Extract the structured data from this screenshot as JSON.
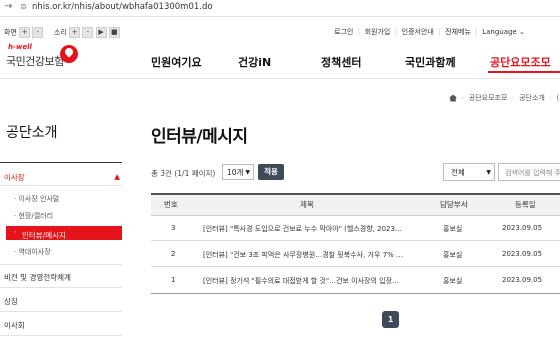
{
  "browser": {
    "url": "nhis.or.kr/nhis/about/wbhafa01300m01.do"
  },
  "util": {
    "screen_label": "화면",
    "sound_label": "소리",
    "zoom_in": "+",
    "zoom_reset": "-",
    "zoom_out": "-",
    "sound_play": "▶",
    "sound_stop": "■",
    "links": [
      "로그인",
      "회원가입",
      "인증서안내",
      "전체메뉴"
    ],
    "language": "Language"
  },
  "logo": {
    "top": "h-well",
    "name": "국민건강보험"
  },
  "gnb": [
    "민원여기요",
    "건강iN",
    "정책센터",
    "국민과함께",
    "공단요모조모"
  ],
  "breadcrumb": [
    "공단요모조모",
    "공단소개",
    "("
  ],
  "sidebar": {
    "title": "공단소개",
    "section": "이사장",
    "subitems": [
      "이사장 인사말",
      "현장/갤러리",
      "인터뷰/메시지",
      "역대이사장"
    ],
    "others": [
      "비전 및 경영전략체계",
      "상징",
      "이사회"
    ]
  },
  "content": {
    "title": "인터뷰/메시지",
    "count_text": "총 3건 (1/1 페이지)",
    "per_page": "10개",
    "apply": "적용",
    "scope": "전체",
    "search_placeholder": "검색어를 입력해 주",
    "headers": [
      "번호",
      "제목",
      "담당부서",
      "등록일"
    ],
    "rows": [
      {
        "no": "3",
        "title": "[인터뷰] \"특사경 도입으로 건보료 누수 막아야\" (헬스경향, 2023…",
        "dept": "홍보실",
        "date": "2023.09.05"
      },
      {
        "no": "2",
        "title": "[인터뷰] \"건보 3조 피먹은 사무장병원…경찰 뒷북수사, 거우 7% …",
        "dept": "홍보실",
        "date": "2023.09.05"
      },
      {
        "no": "1",
        "title": "[인터뷰] 정기석 \"필수의료 대접받게 할 것\"…건보 이사장의 입장은…",
        "dept": "홍보실",
        "date": "2023.09.05"
      }
    ],
    "page": "1"
  },
  "colors": {
    "accent": "#e7131b",
    "button": "#3e4a5a"
  }
}
